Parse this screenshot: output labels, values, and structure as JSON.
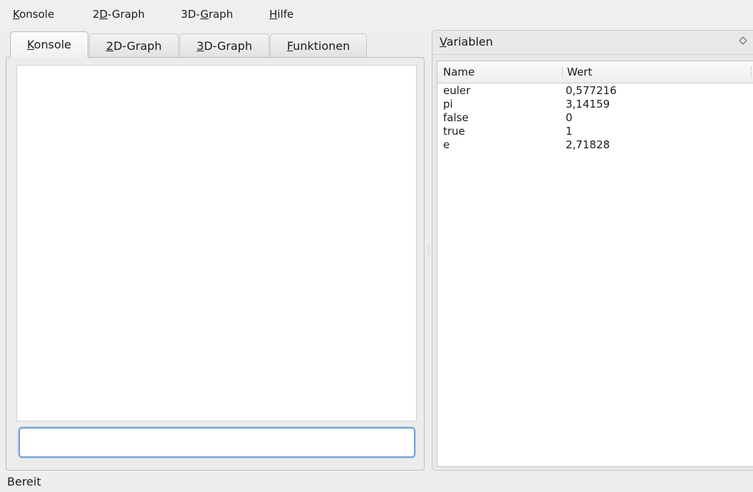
{
  "menubar": {
    "items": [
      {
        "pre": "",
        "mn": "K",
        "post": "onsole"
      },
      {
        "pre": "2",
        "mn": "D",
        "post": "-Graph"
      },
      {
        "pre": "3D-",
        "mn": "G",
        "post": "raph"
      },
      {
        "pre": "",
        "mn": "H",
        "post": "ilfe"
      }
    ]
  },
  "tabs": [
    {
      "pre": "",
      "mn": "K",
      "post": "onsole"
    },
    {
      "pre": "",
      "mn": "2",
      "post": "D-Graph"
    },
    {
      "pre": "",
      "mn": "3",
      "post": "D-Graph"
    },
    {
      "pre": "",
      "mn": "F",
      "post": "unktionen"
    }
  ],
  "console": {
    "input_value": ""
  },
  "variables": {
    "title_mn": "V",
    "title_post": "ariablen",
    "columns": [
      "Name",
      "Wert"
    ],
    "rows": [
      {
        "name": "euler",
        "value": "0,577216"
      },
      {
        "name": "pi",
        "value": "3,14159"
      },
      {
        "name": "false",
        "value": "0"
      },
      {
        "name": "true",
        "value": "1"
      },
      {
        "name": "e",
        "value": "2,71828"
      }
    ]
  },
  "status": {
    "text": "Bereit"
  }
}
